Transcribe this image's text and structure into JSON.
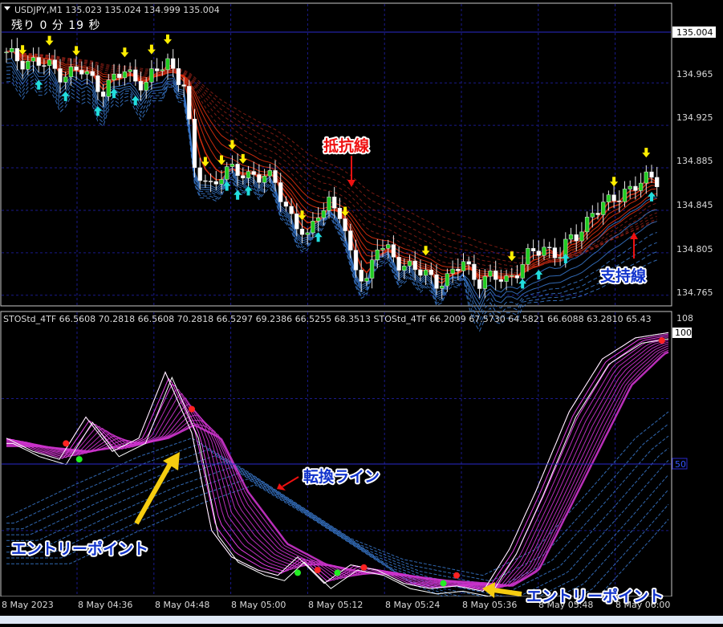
{
  "symbol_header": "USDJPY,M1  135.023 135.024 134.999 135.004",
  "timer_text": "残り 0 分 19 秒",
  "current_price_label": "135.004",
  "price_ticks": [
    "134.965",
    "134.925",
    "134.885",
    "134.845",
    "134.805",
    "134.765"
  ],
  "osc_header": "STOStd_4TF 66.5608 70.2818 66.5608 70.2818 66.5297 69.2386 66.5255 68.3513   STOStd_4TF 66.2009 67.5730 64.5821 66.6088 63.2810 65.43",
  "osc_axis": {
    "top": "108",
    "upper": "100",
    "mid": "50"
  },
  "time_ticks": [
    "8 May 2023",
    "8 May 04:36",
    "8 May 04:48",
    "8 May 05:00",
    "8 May 05:12",
    "8 May 05:24",
    "8 May 05:36",
    "8 May 05:48",
    "8 May 06:00"
  ],
  "annotations": {
    "resistance": "抵抗線",
    "support": "支持線",
    "turn_line": "転換ライン",
    "entry_left": "エントリーポイント",
    "entry_right": "エントリーポイント"
  },
  "colors": {
    "bull": "#22cc22",
    "bear": "#ffffff",
    "resistance": "#e03010",
    "support": "#3a7ad0",
    "stoch_main": "#ff55ff",
    "stoch_signal": "#3a7ad0",
    "grid": "#1a1a8a",
    "up_arrow": "#22dddd",
    "down_arrow": "#ffee00",
    "annotation_red": "#ee1111",
    "annotation_blue": "#1133cc",
    "annotation_arrow": "#f5cc10"
  },
  "chart_data": [
    {
      "type": "candlestick",
      "title": "USDJPY,M1",
      "x_range": [
        "8 May 04:24",
        "8 May 06:02"
      ],
      "ylim": [
        134.755,
        135.04
      ],
      "last_price": 135.004,
      "close_path": [
        [
          0,
          134.99
        ],
        [
          5,
          134.985
        ],
        [
          10,
          134.975
        ],
        [
          14,
          134.975
        ],
        [
          18,
          134.96
        ],
        [
          22,
          134.975
        ],
        [
          26,
          134.965
        ],
        [
          30,
          134.985
        ],
        [
          33,
          134.965
        ],
        [
          35,
          134.88
        ],
        [
          38,
          134.87
        ],
        [
          40,
          134.88
        ],
        [
          46,
          134.88
        ],
        [
          50,
          134.87
        ],
        [
          53,
          134.84
        ],
        [
          56,
          134.815
        ],
        [
          58,
          134.845
        ],
        [
          60,
          134.855
        ],
        [
          62,
          134.84
        ],
        [
          64,
          134.8
        ],
        [
          67,
          134.78
        ],
        [
          69,
          134.81
        ],
        [
          71,
          134.805
        ],
        [
          74,
          134.795
        ],
        [
          77,
          134.785
        ],
        [
          80,
          134.78
        ],
        [
          82,
          134.78
        ],
        [
          85,
          134.795
        ],
        [
          88,
          134.78
        ],
        [
          91,
          134.78
        ],
        [
          93,
          134.78
        ],
        [
          95,
          134.79
        ],
        [
          97,
          134.8
        ],
        [
          100,
          134.81
        ],
        [
          103,
          134.805
        ],
        [
          106,
          134.82
        ],
        [
          109,
          134.845
        ],
        [
          112,
          134.85
        ],
        [
          115,
          134.865
        ],
        [
          118,
          134.87
        ],
        [
          121,
          134.875
        ]
      ],
      "down_arrows_at": [
        3,
        8,
        13,
        22,
        27,
        30,
        37,
        40,
        42,
        44,
        55,
        63,
        78,
        94,
        113,
        119
      ],
      "up_arrows_at": [
        6,
        11,
        17,
        20,
        24,
        41,
        43,
        45,
        58,
        96,
        99,
        104,
        120
      ]
    },
    {
      "type": "line",
      "title": "STOStd_4TF",
      "ylim": [
        0,
        108
      ],
      "levels": [
        100,
        50
      ],
      "series": [
        {
          "values_path": [
            [
              0,
              60
            ],
            [
              4,
              55
            ],
            [
              8,
              52
            ],
            [
              12,
              68
            ],
            [
              16,
              55
            ],
            [
              20,
              60
            ],
            [
              24,
              85
            ],
            [
              28,
              62
            ],
            [
              31,
              25
            ],
            [
              34,
              15
            ],
            [
              38,
              10
            ],
            [
              41,
              8
            ],
            [
              44,
              15
            ],
            [
              46,
              10
            ],
            [
              48,
              5
            ],
            [
              52,
              12
            ],
            [
              56,
              10
            ],
            [
              60,
              5
            ],
            [
              64,
              3
            ],
            [
              68,
              4
            ],
            [
              72,
              2
            ],
            [
              76,
              18
            ],
            [
              80,
              40
            ],
            [
              85,
              70
            ],
            [
              90,
              90
            ],
            [
              95,
              98
            ],
            [
              100,
              100
            ]
          ]
        },
        {
          "values_path": [
            [
              0,
              57
            ],
            [
              8,
              55
            ],
            [
              16,
              58
            ],
            [
              20,
              60
            ],
            [
              24,
              65
            ],
            [
              28,
              60
            ],
            [
              32,
              40
            ],
            [
              38,
              20
            ],
            [
              44,
              12
            ],
            [
              50,
              9
            ],
            [
              56,
              8
            ],
            [
              62,
              6
            ],
            [
              68,
              5
            ],
            [
              72,
              4
            ],
            [
              76,
              10
            ],
            [
              80,
              30
            ],
            [
              85,
              55
            ],
            [
              90,
              80
            ],
            [
              95,
              92
            ],
            [
              100,
              97
            ]
          ]
        },
        {
          "values_path": [
            [
              0,
              30
            ],
            [
              10,
              42
            ],
            [
              20,
              53
            ],
            [
              28,
              60
            ],
            [
              36,
              48
            ],
            [
              44,
              35
            ],
            [
              52,
              22
            ],
            [
              60,
              14
            ],
            [
              68,
              10
            ],
            [
              72,
              8
            ],
            [
              80,
              18
            ],
            [
              88,
              40
            ],
            [
              95,
              60
            ],
            [
              100,
              70
            ]
          ]
        }
      ],
      "red_dots": [
        [
          9,
          58
        ],
        [
          28,
          71
        ],
        [
          47,
          10
        ],
        [
          54,
          11
        ],
        [
          68,
          8
        ],
        [
          99,
          97
        ]
      ],
      "green_dots": [
        [
          11,
          52
        ],
        [
          44,
          9
        ],
        [
          50,
          9
        ],
        [
          66,
          5
        ]
      ]
    }
  ]
}
